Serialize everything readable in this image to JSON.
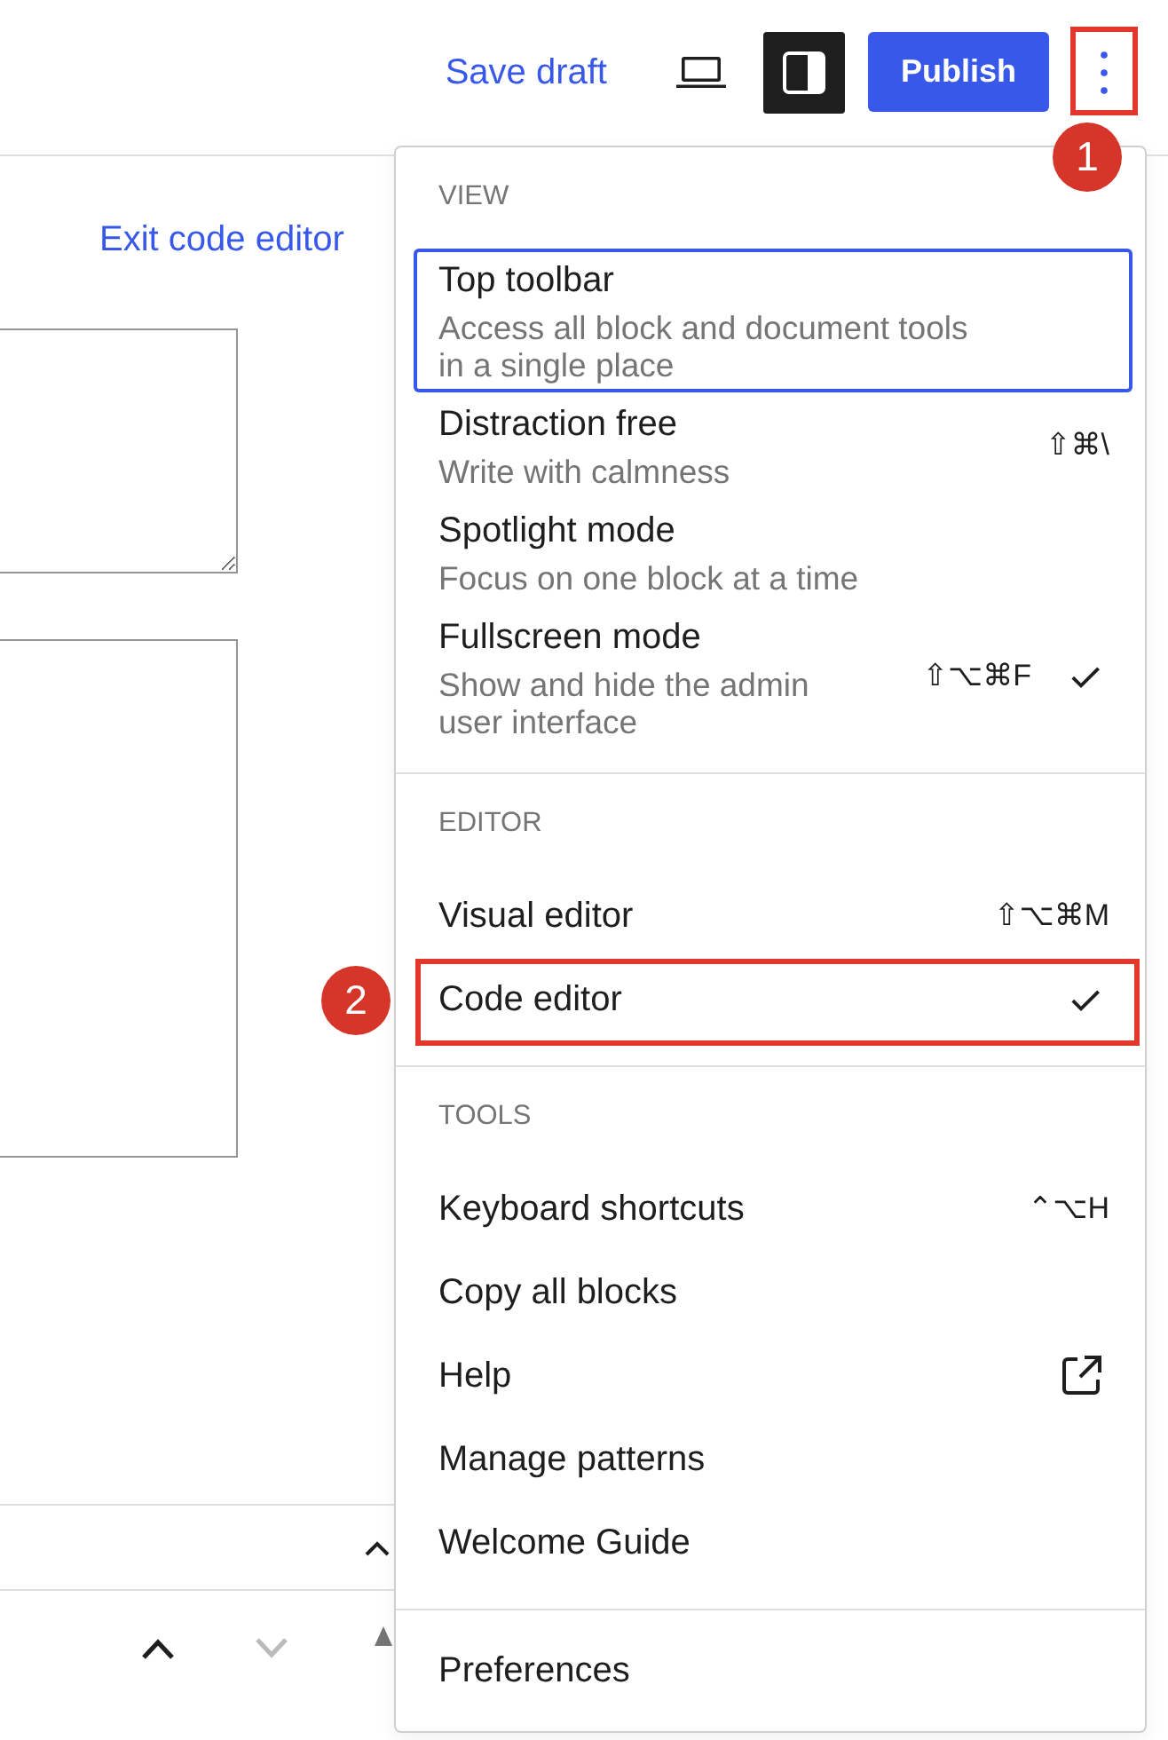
{
  "header": {
    "save_draft": "Save draft",
    "sidebar_toggle": {
      "pressed": true
    },
    "publish": "Publish",
    "options_button": {
      "expanded": true,
      "annotation": "1"
    }
  },
  "code_editor": {
    "exit_link": "Exit code editor"
  },
  "block_mover": {
    "move_up": {
      "disabled": false
    },
    "move_down": {
      "disabled": true
    }
  },
  "options_menu": {
    "sections": [
      {
        "label": "VIEW",
        "items": [
          {
            "kind": "toggle",
            "title": "Top toolbar",
            "description": "Access all block and document tools in a single place",
            "checked": false,
            "focused": true
          },
          {
            "kind": "toggle",
            "title": "Distraction free",
            "description": "Write with calmness",
            "shortcut": "⇧⌘\\",
            "checked": false,
            "focused": false
          },
          {
            "kind": "toggle",
            "title": "Spotlight mode",
            "description": "Focus on one block at a time",
            "checked": false,
            "focused": false
          },
          {
            "kind": "toggle",
            "title": "Fullscreen mode",
            "description": "Show and hide the admin user interface",
            "shortcut": "⇧⌥⌘F",
            "checked": true,
            "focused": false
          }
        ]
      },
      {
        "label": "EDITOR",
        "items": [
          {
            "kind": "choice",
            "title": "Visual editor",
            "shortcut": "⇧⌥⌘M",
            "selected": false,
            "focused": false
          },
          {
            "kind": "choice",
            "title": "Code editor",
            "selected": true,
            "focused": false,
            "annotation": "2"
          }
        ]
      },
      {
        "label": "TOOLS",
        "items": [
          {
            "kind": "action",
            "title": "Keyboard shortcuts",
            "shortcut": "⌃⌥H",
            "focused": false
          },
          {
            "kind": "action",
            "title": "Copy all blocks",
            "focused": false
          },
          {
            "kind": "external_link",
            "title": "Help",
            "focused": false
          },
          {
            "kind": "action",
            "title": "Manage patterns",
            "focused": false
          },
          {
            "kind": "action",
            "title": "Welcome Guide",
            "focused": false
          }
        ]
      },
      {
        "items": [
          {
            "kind": "action",
            "title": "Preferences",
            "focused": false
          }
        ]
      }
    ]
  }
}
